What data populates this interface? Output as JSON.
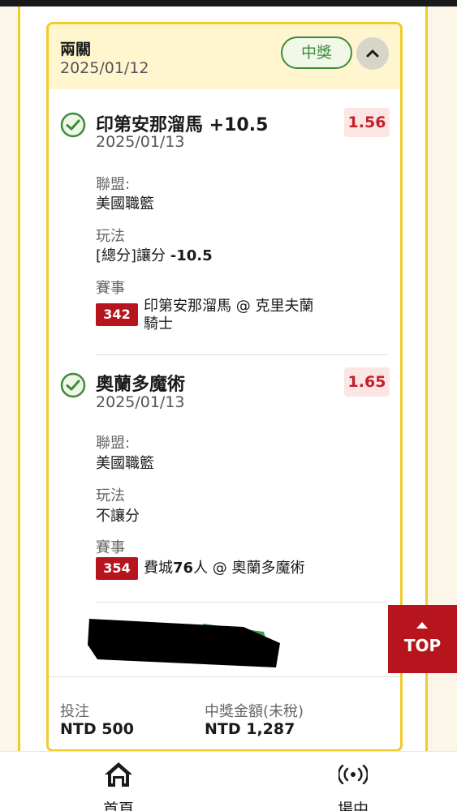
{
  "bet": {
    "type": "兩關",
    "date": "2025/01/12",
    "status_badge": "中獎",
    "legs": [
      {
        "title": "印第安那溜馬 +10.5",
        "date": "2025/01/13",
        "odds": "1.56",
        "league_label": "聯盟:",
        "league": "美國職籃",
        "play_label": "玩法",
        "play_prefix": "[總分]讓分 ",
        "play_value": "-10.5",
        "event_label": "賽事",
        "event_no": "342",
        "event_line1": "印第安那溜馬 @ 克里夫蘭",
        "event_line2": "騎士"
      },
      {
        "title": "奧蘭多魔術",
        "date": "2025/01/13",
        "odds": "1.65",
        "league_label": "聯盟:",
        "league": "美國職籃",
        "play_label": "玩法",
        "play_value": "不讓分",
        "event_label": "賽事",
        "event_no": "354",
        "event_team": "費城",
        "event_num": "76",
        "event_rest": "人 @ 奧蘭多魔術"
      }
    ],
    "stake_label": "投注",
    "stake": "NTD 500",
    "payout_label": "中獎金額(未稅)",
    "payout": "NTD 1,287"
  },
  "top_button": "TOP",
  "nav": {
    "home": "首頁",
    "live": "場中"
  },
  "colors": {
    "accent_yellow": "#f0cb2c",
    "win_green": "#3f8a3a",
    "brand_red": "#b7151d"
  }
}
